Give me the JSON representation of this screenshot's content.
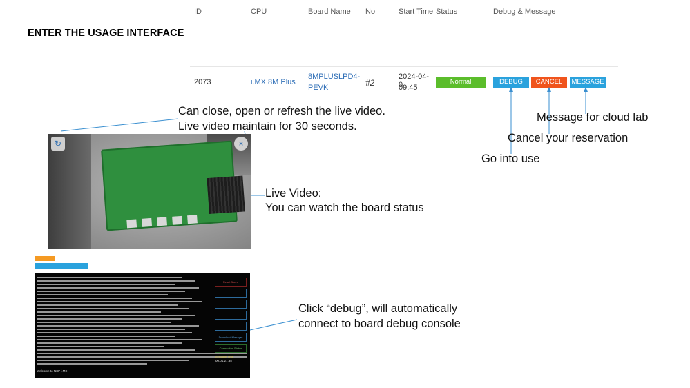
{
  "title": "ENTER THE USAGE INTERFACE",
  "table": {
    "headers": [
      "ID",
      "CPU",
      "Board Name",
      "No",
      "Start Time",
      "Status",
      "Debug & Message"
    ],
    "row": {
      "id": "2073",
      "cpu": "i.MX 8M Plus",
      "board_name_line1": "8MPLUSLPD4-",
      "board_name_line2": "PEVK",
      "no": "#2",
      "start_time_line1": "2024-04-0",
      "start_time_line2": "09:45",
      "status": "Normal",
      "buttons": {
        "debug": "DEBUG",
        "cancel": "CANCEL",
        "message": "MESSAGE"
      }
    }
  },
  "annotations": {
    "video_controls_line1": "Can close, open or refresh the live video.",
    "video_controls_line2": "Live video maintain for 30 seconds.",
    "message": "Message for cloud lab",
    "cancel": "Cancel your reservation",
    "debug": "Go into use",
    "live_video_line1": "Live Video:",
    "live_video_line2": "You can watch the board status",
    "console_line1": "Click “debug”, will automatically",
    "console_line2": "connect to board debug console"
  },
  "console": {
    "prompt": "Welcome to NXP i.MX",
    "side_buttons": [
      "Reset Board",
      "",
      "",
      "",
      "",
      "",
      "Download Manager",
      "Connection Status"
    ],
    "timer_label": "Available Time",
    "timer_value": "00:01:27:35"
  },
  "colors": {
    "accent_blue": "#2aa2dd",
    "cancel_orange": "#f0541c",
    "status_green": "#5bbd2b",
    "link_blue": "#2f6fb7"
  },
  "icons": {
    "refresh": "refresh-icon",
    "close": "close-icon"
  }
}
